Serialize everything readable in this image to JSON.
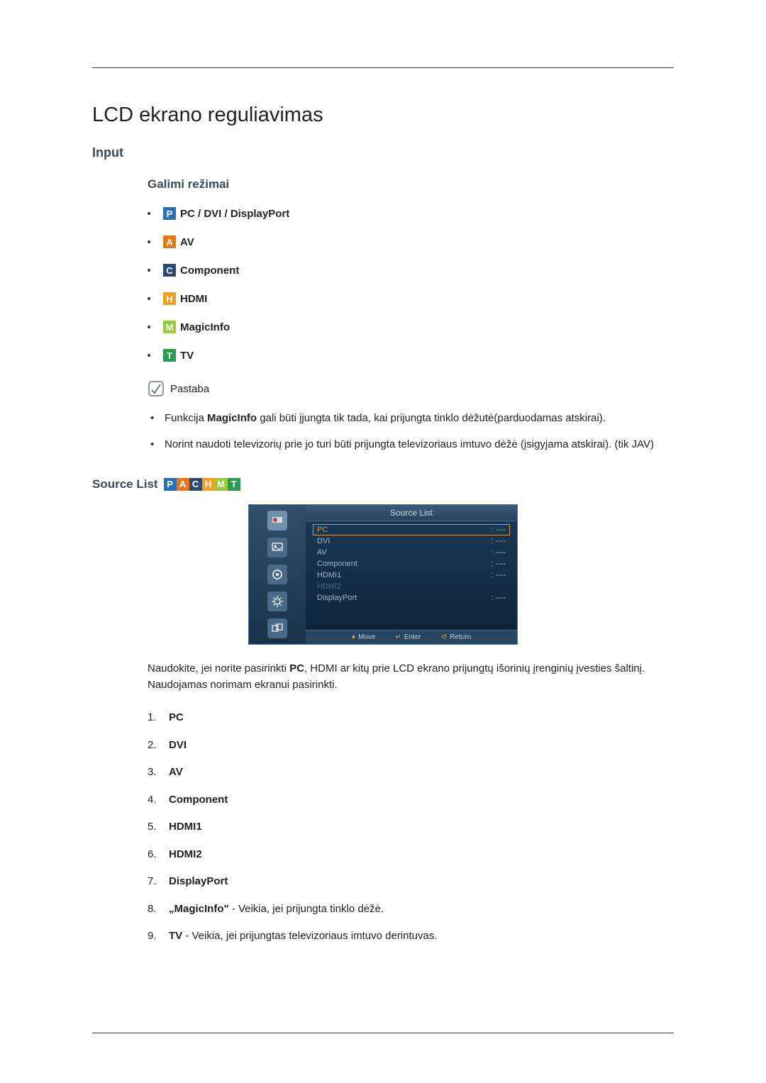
{
  "page_title": "LCD ekrano reguliavimas",
  "input_heading": "Input",
  "modes_heading": "Galimi režimai",
  "modes": [
    {
      "icon_letter": "P",
      "icon_class": "icon-p",
      "label": "PC / DVI / DisplayPort"
    },
    {
      "icon_letter": "A",
      "icon_class": "icon-a",
      "label": "AV"
    },
    {
      "icon_letter": "C",
      "icon_class": "icon-c",
      "label": "Component"
    },
    {
      "icon_letter": "H",
      "icon_class": "icon-h",
      "label": "HDMI"
    },
    {
      "icon_letter": "M",
      "icon_class": "icon-m",
      "label": "MagicInfo"
    },
    {
      "icon_letter": "T",
      "icon_class": "icon-t",
      "label": "TV"
    }
  ],
  "note_title": "Pastaba",
  "notes": [
    {
      "prefix": "Funkcija ",
      "bold": "MagicInfo",
      "rest": " gali būti įjungta tik tada, kai prijungta tinklo dėžutė(parduodamas atskirai)."
    },
    {
      "prefix": "",
      "bold": "",
      "rest": "Norint naudoti televizorių prie jo turi būti prijungta televizoriaus imtuvo dėžė (įsigyjama atskirai). (tik JAV)"
    }
  ],
  "source_list_heading": "Source List",
  "osd": {
    "header": "Source List",
    "rows": [
      {
        "label": "PC",
        "value": ": ----",
        "state": "selected"
      },
      {
        "label": "DVI",
        "value": ": ----",
        "state": ""
      },
      {
        "label": "AV",
        "value": ": ----",
        "state": ""
      },
      {
        "label": "Component",
        "value": ": ----",
        "state": ""
      },
      {
        "label": "HDMI1",
        "value": ": ----",
        "state": ""
      },
      {
        "label": "HDMI2",
        "value": "",
        "state": "dim"
      },
      {
        "label": "DisplayPort",
        "value": ": ----",
        "state": ""
      }
    ],
    "footer": {
      "move": "Move",
      "enter": "Enter",
      "return": "Return"
    }
  },
  "description_prefix": "Naudokite, jei norite pasirinkti ",
  "description_bold": "PC",
  "description_rest": ", HDMI ar kitų prie LCD ekrano prijungtų išorinių įrenginių įvesties šaltinį. Naudojamas norimam ekranui pasirinkti.",
  "sources": [
    {
      "bold": "PC",
      "rest": ""
    },
    {
      "bold": "DVI",
      "rest": ""
    },
    {
      "bold": "AV",
      "rest": ""
    },
    {
      "bold": "Component",
      "rest": ""
    },
    {
      "bold": "HDMI1",
      "rest": ""
    },
    {
      "bold": "HDMI2",
      "rest": ""
    },
    {
      "bold": "DisplayPort",
      "rest": ""
    },
    {
      "bold": "„MagicInfo\"",
      "rest": " - Veikia, jei prijungta tinklo dėžė."
    },
    {
      "bold": "TV",
      "rest": " - Veikia, jei prijungtas televizoriaus imtuvo derintuvas."
    }
  ]
}
